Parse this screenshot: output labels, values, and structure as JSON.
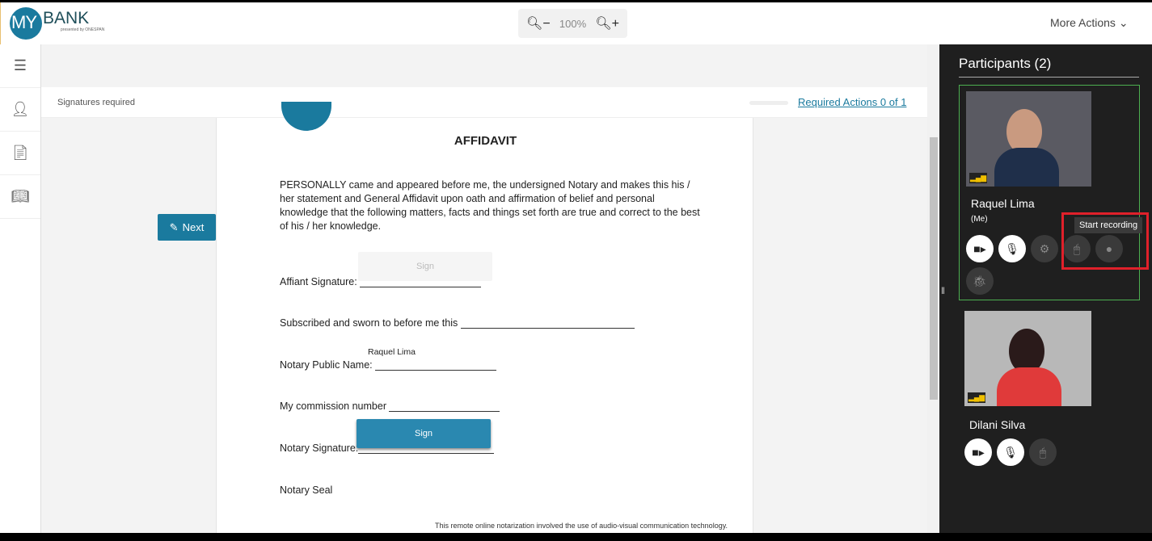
{
  "header": {
    "logo": {
      "my": "MY",
      "bank": "BANK",
      "sub": "presented by ONESPAN"
    },
    "zoom_level": "100%",
    "more_actions": "More Actions"
  },
  "sidebar": {
    "items": [
      {
        "icon": "menu-icon"
      },
      {
        "icon": "user-sign-icon"
      },
      {
        "icon": "document-icon"
      },
      {
        "icon": "book-icon"
      }
    ]
  },
  "toolbar": {
    "status": "Signatures required",
    "required_actions": "Required Actions 0 of 1",
    "next": "Next"
  },
  "document": {
    "title": "AFFIDAVIT",
    "body": "PERSONALLY came and appeared before me, the undersigned Notary and makes this his / her statement and General Affidavit upon oath and affirmation of belief and personal knowledge that the following matters, facts and things set forth are true and correct to the best of his / her knowledge.",
    "affiant_signature": "Affiant Signature:",
    "sign_disabled": "Sign",
    "subscribed": "Subscribed and sworn to before me this",
    "notary_name_value": "Raquel Lima",
    "notary_name": "Notary Public Name:",
    "commission": "My commission number",
    "notary_signature": "Notary Signature:",
    "sign": "Sign",
    "seal": "Notary Seal",
    "footer": "This remote online notarization involved the use of audio-visual communication technology."
  },
  "participants": {
    "title": "Participants (2)",
    "list": [
      {
        "name": "Raquel Lima",
        "tag": "(Me)",
        "tooltip": "Start recording"
      },
      {
        "name": "Dilani Silva"
      }
    ]
  },
  "colors": {
    "accent": "#1a7a9e",
    "highlight": "#e0202a",
    "active_border": "#4caf50"
  }
}
